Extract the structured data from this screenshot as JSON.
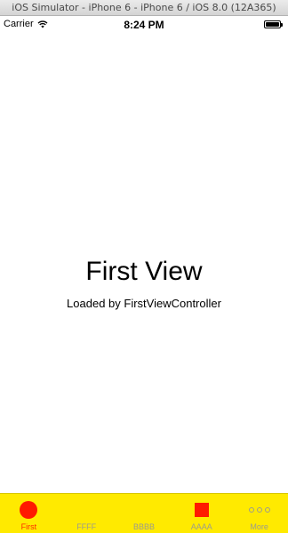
{
  "simulator": {
    "title": "iOS Simulator - iPhone 6 - iPhone 6 / iOS 8.0 (12A365)"
  },
  "status_bar": {
    "carrier": "Carrier",
    "time": "8:24 PM"
  },
  "main": {
    "title": "First View",
    "subtitle": "Loaded by FirstViewController"
  },
  "tab_bar": {
    "background_color": "#ffea00",
    "active_color": "#ff2a00",
    "items": [
      {
        "label": "First",
        "icon": "circle-icon",
        "active": true
      },
      {
        "label": "FFFF",
        "icon": "none",
        "active": false
      },
      {
        "label": "BBBB",
        "icon": "none",
        "active": false
      },
      {
        "label": "AAAA",
        "icon": "square-icon",
        "active": false
      },
      {
        "label": "More",
        "icon": "more-icon",
        "active": false
      }
    ]
  }
}
